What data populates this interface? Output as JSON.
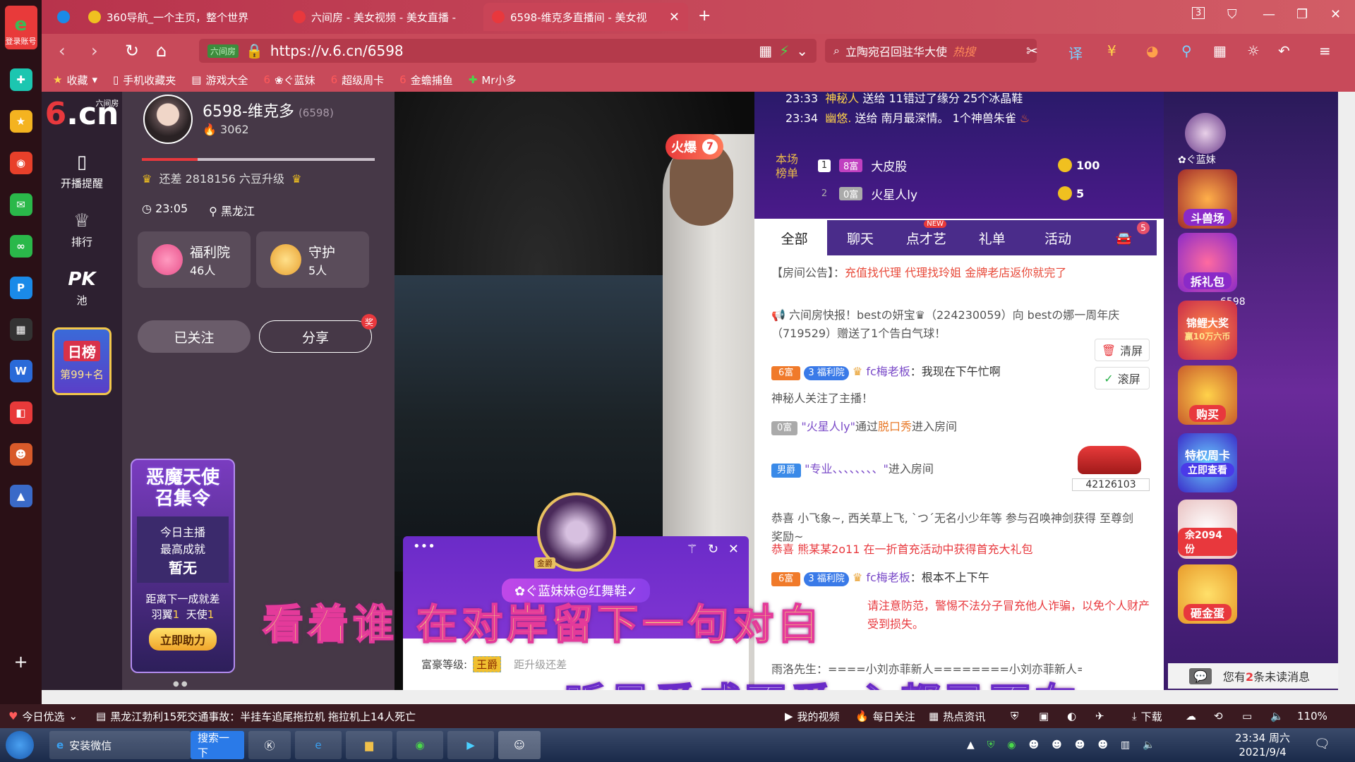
{
  "browser": {
    "login_label": "登录账号",
    "tabs": [
      {
        "title": "360导航_一个主页，整个世界"
      },
      {
        "title": "六间房 - 美女视频 - 美女直播 -"
      },
      {
        "title": "6598-维克多直播间 - 美女视"
      }
    ],
    "tab_count": "3",
    "url": "https://v.6.cn/6598",
    "url_badge": "六间房",
    "search_text": "立陶宛召回驻华大使",
    "search_hot": "热搜",
    "bookmarks": [
      "收藏",
      "手机收藏夹",
      "游戏大全",
      "❀ぐ蓝妹",
      "超级周卡",
      "金蟾捕鱼",
      "Mr小多"
    ],
    "zoom": "110%"
  },
  "left_nav": {
    "brand": "6.cn",
    "brand_sub": "六间房",
    "items": [
      {
        "label": "开播提醒"
      },
      {
        "label": "排行"
      },
      {
        "label": "PK池"
      }
    ],
    "day_rank": {
      "title": "日榜",
      "rank": "第99+名"
    }
  },
  "anchor": {
    "name": "6598-维克多",
    "room_id": "(6598)",
    "hot": "3062",
    "level_text": "还差 2818156 六豆升级",
    "time": "23:05",
    "location": "黑龙江",
    "welfare": {
      "title": "福利院",
      "count": "46人"
    },
    "guard": {
      "title": "守护",
      "count": "5人"
    },
    "follow_label": "已关注",
    "share_label": "分享",
    "share_badge": "奖"
  },
  "promo": {
    "title": "恶魔天使\n召集令",
    "line1": "今日主播",
    "line2": "最高成就",
    "line3": "暂无",
    "next_label": "距离下一成就差",
    "wing_label": "羽翼",
    "wing_count": "1",
    "angel_label": "天使",
    "angel_count": "1",
    "button": "立即助力"
  },
  "video": {
    "hot_label": "火爆",
    "hot_num": "7",
    "popup_name": "✿ぐ蓝妹妹@红舞鞋✓",
    "popup_wealth_label": "富豪等级:",
    "popup_wealth_value": "王爵",
    "popup_upgrade": "距升级还差",
    "popup_medal": "金爵"
  },
  "subtitles": {
    "line1": "看着谁  在对岸留下一句对白",
    "line2": "听见爱或不爱  心都已不在"
  },
  "chat": {
    "gifts": [
      {
        "time": "23:33",
        "user": "神秘人",
        "text": "送给 11错过了缘分 25个冰晶鞋"
      },
      {
        "time": "23:34",
        "user": "幽悠.",
        "text": "送给 南月最深情。 1个神兽朱雀"
      }
    ],
    "rank_label": "本场榜单",
    "rank": [
      {
        "pos": "1",
        "level": "8富",
        "name": "大皮股",
        "coins": "100"
      },
      {
        "pos": "2",
        "level": "0富",
        "name": "火星人ly",
        "coins": "5"
      }
    ],
    "tabs": [
      {
        "label": "全部"
      },
      {
        "label": "聊天"
      },
      {
        "label": "点才艺",
        "badge": "NEW"
      },
      {
        "label": "礼单"
      },
      {
        "label": "活动"
      },
      {
        "label": "",
        "badge": "5"
      }
    ],
    "notice_label": "【房间公告】：",
    "notice_text": "充值找代理 代理找玲姐 金牌老店返你就完了",
    "express": "六间房快报！bestの妍宝♛（224230059）向 bestの娜一周年庆（719529）赠送了1个告白气球！",
    "msg1": {
      "level": "6富",
      "badge_num": "3",
      "badge": "福利院",
      "user": "fc梅老板",
      "text": "：我现在下午忙啊"
    },
    "follow_msg": "神秘人关注了主播！",
    "enter1": {
      "level": "0富",
      "user": "\"火星人ly\"",
      "via": "通过",
      "link": "脱口秀",
      "text": "进入房间"
    },
    "enter2": {
      "level": "男爵",
      "user": "\"专业、、、、、、、、\"",
      "text": "进入房间",
      "car_num": "42126103"
    },
    "congrats1": "恭喜 小飞象~, 西关草上飞, ˋつˊ无名小少年等 参与召唤神剑获得 至尊剑奖励~",
    "congrats2": "恭喜 熊某某2o11 在一折首充活动中获得首充大礼包",
    "msg2": {
      "level": "6富",
      "badge_num": "3",
      "badge": "福利院",
      "user": "fc梅老板",
      "text": "：根本不上下午"
    },
    "warning": "请注意防范，警惕不法分子冒充他人诈骗，以免个人财产受到损失。",
    "last": "雨洛先生：====小刘亦菲新人========小刘亦菲新人========小刘亦",
    "clear_label": "清屏",
    "scroll_label": "滚屏",
    "unread_pre": "您有",
    "unread_count": "2",
    "unread_post": "条未读消息"
  },
  "right_rail": {
    "user_label": "✿ぐ蓝妹",
    "items": [
      "斗兽场",
      "拆礼包",
      "锦鲤大奖",
      "购买",
      "特权周卡",
      "立即查看",
      "余2094份",
      "砸金蛋"
    ],
    "room_label": "6598",
    "koi_sub": "赢10万六币"
  },
  "statusbar": {
    "news_label": "今日优选",
    "news_text": "黑龙江勃利15死交通事故：半挂车追尾拖拉机 拖拉机上14人死亡",
    "items": [
      "我的视频",
      "每日关注",
      "热点资讯",
      "下载"
    ]
  },
  "taskbar": {
    "ie_label": "安装微信",
    "search_label": "搜索一下",
    "time": "23:34 周六",
    "date": "2021/9/4"
  }
}
